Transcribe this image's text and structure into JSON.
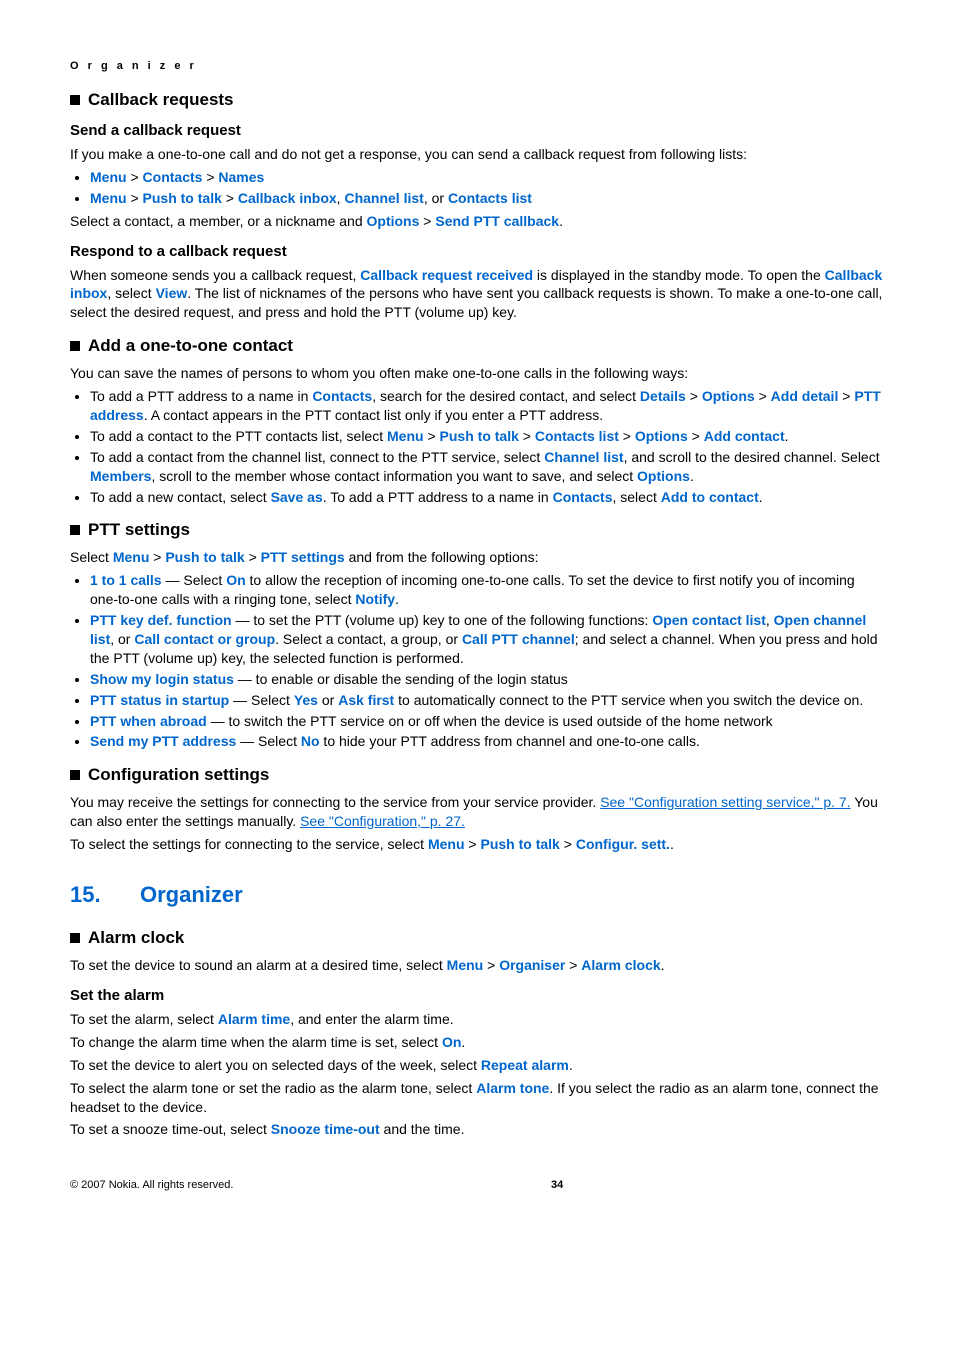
{
  "running_header": "O r g a n i z e r",
  "sec_callback": "Callback requests",
  "h_send_cb": "Send a callback request",
  "p_send_cb_intro": "If you make a one-to-one call and do not get a response, you can send a callback request from following lists:",
  "b1_menu": "Menu",
  "b1_contacts": "Contacts",
  "b1_names": "Names",
  "b2_ptt": "Push to talk",
  "b2_cbinbox": "Callback inbox",
  "b2_chlist": "Channel list",
  "b2_or": ", or ",
  "b2_contlist": "Contacts list",
  "p_select_contact_pre": "Select a contact, a member, or a nickname and ",
  "p_options": "Options",
  "p_send_ptt_cb": "Send PTT callback",
  "h_respond": "Respond to a callback request",
  "p_respond_1a": "When someone sends you a callback request, ",
  "p_respond_cbreq": "Callback request received",
  "p_respond_1b": " is displayed in the standby mode. To open the ",
  "p_respond_cbinbox": "Callback inbox",
  "p_respond_1c": ", select ",
  "p_respond_view": "View",
  "p_respond_1d": ". The list of nicknames of the persons who have sent you callback requests is shown. To make a one-to-one call, select the desired request, and press and hold the PTT (volume up) key.",
  "sec_add121": "Add a one-to-one contact",
  "p_add121_intro": "You can save the names of persons to whom you often make one-to-one calls in the following ways:",
  "li_a1_a": "To add a PTT address to a name in ",
  "li_a1_contacts": "Contacts",
  "li_a1_b": ", search for the desired contact, and select ",
  "li_a1_details": "Details",
  "li_a1_options": "Options",
  "li_a1_adddetail": "Add detail",
  "li_a1_pttaddr": "PTT address",
  "li_a1_c": ". A contact appears in the PTT contact list only if you enter a PTT address.",
  "li_a2_a": "To add a contact to the PTT contacts list, select ",
  "li_a2_menu": "Menu",
  "li_a2_ptt": "Push to talk",
  "li_a2_contlist": "Contacts list",
  "li_a2_options": "Options",
  "li_a2_addcontact": "Add contact",
  "li_a3_a": "To add a contact from the channel list, connect to the PTT service, select ",
  "li_a3_chlist": "Channel list",
  "li_a3_b": ", and scroll to the desired channel. Select ",
  "li_a3_members": "Members",
  "li_a3_c": ", scroll to the member whose contact information you want to save, and select ",
  "li_a3_options": "Options",
  "li_a4_a": "To add a new contact, select ",
  "li_a4_saveas": "Save as",
  "li_a4_b": ". To add a PTT address to a name in ",
  "li_a4_contacts": "Contacts",
  "li_a4_c": ", select ",
  "li_a4_addto": "Add to contact",
  "sec_ptt": "PTT settings",
  "p_ptt_sel_a": "Select ",
  "p_ptt_menu": "Menu",
  "p_ptt_ptt": "Push to talk",
  "p_ptt_settings": "PTT settings",
  "p_ptt_sel_b": " and from the following options:",
  "li_p1_key": "1 to 1 calls",
  "li_p1_a": " — Select ",
  "li_p1_on": "On",
  "li_p1_b": " to allow the reception of incoming one-to-one calls. To set the device to first notify you of incoming one-to-one calls with a ringing tone, select ",
  "li_p1_notify": "Notify",
  "li_p2_key": "PTT key def. function",
  "li_p2_a": " — to set the PTT (volume up) key to one of the following functions: ",
  "li_p2_opencl": "Open contact list",
  "li_p2_openchl": "Open channel list",
  "li_p2_or1": ", or ",
  "li_p2_callgrp": "Call contact or group",
  "li_p2_b": ". Select a contact, a group, or ",
  "li_p2_callch": "Call PTT channel",
  "li_p2_c": "; and select a channel. When you press and hold the PTT (volume up) key, the selected function is performed.",
  "li_p3_key": "Show my login status",
  "li_p3_a": " — to enable or disable the sending of the login status",
  "li_p4_key": "PTT status in startup",
  "li_p4_a": " — Select ",
  "li_p4_yes": "Yes",
  "li_p4_or": " or ",
  "li_p4_ask": "Ask first",
  "li_p4_b": " to automatically connect to the PTT service when you switch the device on.",
  "li_p5_key": "PTT when abroad",
  "li_p5_a": " — to switch the PTT service on or off when the device is used outside of the home network",
  "li_p6_key": "Send my PTT address",
  "li_p6_a": " — Select ",
  "li_p6_no": "No",
  "li_p6_b": " to hide your PTT address from channel and one-to-one calls.",
  "sec_config": "Configuration settings",
  "p_cfg1_a": "You may receive the settings for connecting to the service from your service provider. ",
  "p_cfg1_link": "See \"Configuration setting service,\" p. 7.",
  "p_cfg1_b": " You can also enter the settings manually. ",
  "p_cfg1_link2": "See \"Configuration,\" p. 27.",
  "p_cfg2_a": "To select the settings for connecting to the service, select ",
  "p_cfg2_menu": "Menu",
  "p_cfg2_ptt": "Push to talk",
  "p_cfg2_cset": "Configur. sett.",
  "ch_num": "15.",
  "ch_title": "Organizer",
  "sec_alarm": "Alarm clock",
  "p_al1_a": "To set the device to sound an alarm at a desired time, select ",
  "p_al1_menu": "Menu",
  "p_al1_org": "Organiser",
  "p_al1_ac": "Alarm clock",
  "h_setalarm": "Set the alarm",
  "p_sa1_a": "To set the alarm, select ",
  "p_sa1_at": "Alarm time",
  "p_sa1_b": ", and enter the alarm time.",
  "p_sa2_a": "To change the alarm time when the alarm time is set, select ",
  "p_sa2_on": "On",
  "p_sa3_a": "To set the device to alert you on selected days of the week, select ",
  "p_sa3_ra": "Repeat alarm",
  "p_sa4_a": "To select the alarm tone or set the radio as the alarm tone, select ",
  "p_sa4_at": "Alarm tone",
  "p_sa4_b": ". If you select the radio as an alarm tone, connect the headset to the device.",
  "p_sa5_a": "To set a snooze time-out, select ",
  "p_sa5_st": "Snooze time-out",
  "p_sa5_b": " and the time.",
  "footer_copy": "© 2007 Nokia. All rights reserved.",
  "footer_page": "34"
}
